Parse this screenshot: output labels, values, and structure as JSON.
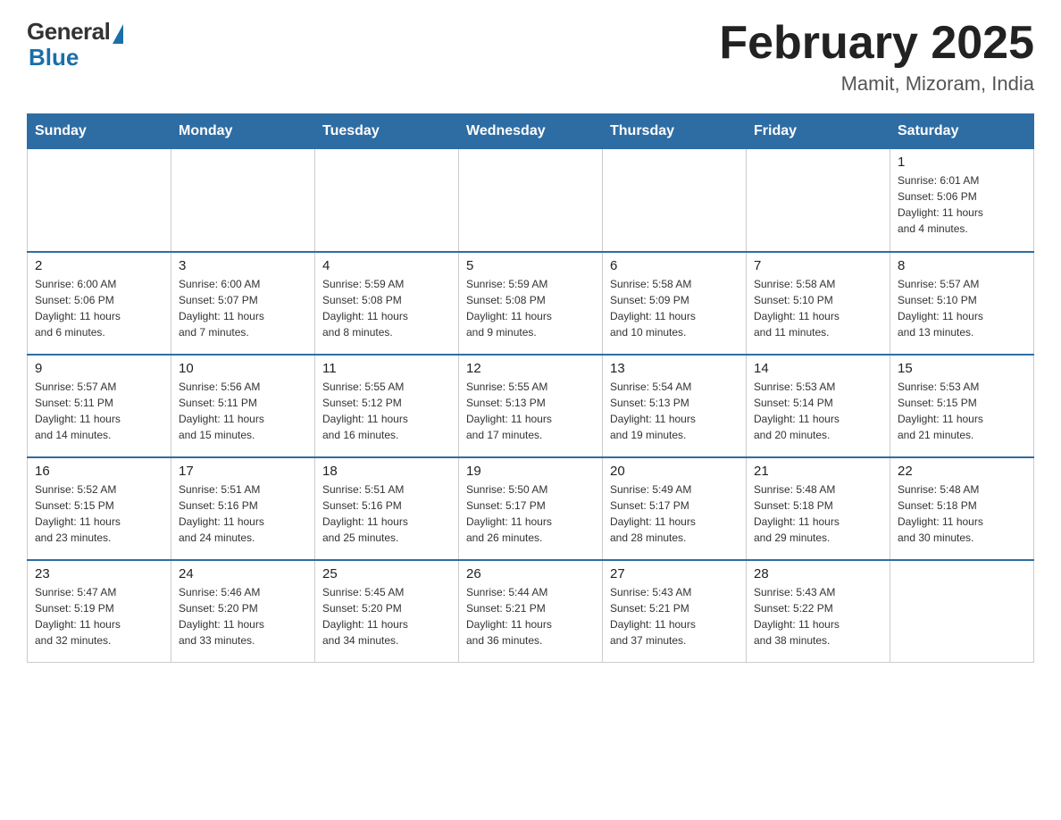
{
  "header": {
    "logo_general": "General",
    "logo_blue": "Blue",
    "month_title": "February 2025",
    "location": "Mamit, Mizoram, India"
  },
  "days_of_week": [
    "Sunday",
    "Monday",
    "Tuesday",
    "Wednesday",
    "Thursday",
    "Friday",
    "Saturday"
  ],
  "weeks": [
    {
      "days": [
        {
          "number": "",
          "info": "",
          "empty": true
        },
        {
          "number": "",
          "info": "",
          "empty": true
        },
        {
          "number": "",
          "info": "",
          "empty": true
        },
        {
          "number": "",
          "info": "",
          "empty": true
        },
        {
          "number": "",
          "info": "",
          "empty": true
        },
        {
          "number": "",
          "info": "",
          "empty": true
        },
        {
          "number": "1",
          "info": "Sunrise: 6:01 AM\nSunset: 5:06 PM\nDaylight: 11 hours\nand 4 minutes."
        }
      ]
    },
    {
      "days": [
        {
          "number": "2",
          "info": "Sunrise: 6:00 AM\nSunset: 5:06 PM\nDaylight: 11 hours\nand 6 minutes."
        },
        {
          "number": "3",
          "info": "Sunrise: 6:00 AM\nSunset: 5:07 PM\nDaylight: 11 hours\nand 7 minutes."
        },
        {
          "number": "4",
          "info": "Sunrise: 5:59 AM\nSunset: 5:08 PM\nDaylight: 11 hours\nand 8 minutes."
        },
        {
          "number": "5",
          "info": "Sunrise: 5:59 AM\nSunset: 5:08 PM\nDaylight: 11 hours\nand 9 minutes."
        },
        {
          "number": "6",
          "info": "Sunrise: 5:58 AM\nSunset: 5:09 PM\nDaylight: 11 hours\nand 10 minutes."
        },
        {
          "number": "7",
          "info": "Sunrise: 5:58 AM\nSunset: 5:10 PM\nDaylight: 11 hours\nand 11 minutes."
        },
        {
          "number": "8",
          "info": "Sunrise: 5:57 AM\nSunset: 5:10 PM\nDaylight: 11 hours\nand 13 minutes."
        }
      ]
    },
    {
      "days": [
        {
          "number": "9",
          "info": "Sunrise: 5:57 AM\nSunset: 5:11 PM\nDaylight: 11 hours\nand 14 minutes."
        },
        {
          "number": "10",
          "info": "Sunrise: 5:56 AM\nSunset: 5:11 PM\nDaylight: 11 hours\nand 15 minutes."
        },
        {
          "number": "11",
          "info": "Sunrise: 5:55 AM\nSunset: 5:12 PM\nDaylight: 11 hours\nand 16 minutes."
        },
        {
          "number": "12",
          "info": "Sunrise: 5:55 AM\nSunset: 5:13 PM\nDaylight: 11 hours\nand 17 minutes."
        },
        {
          "number": "13",
          "info": "Sunrise: 5:54 AM\nSunset: 5:13 PM\nDaylight: 11 hours\nand 19 minutes."
        },
        {
          "number": "14",
          "info": "Sunrise: 5:53 AM\nSunset: 5:14 PM\nDaylight: 11 hours\nand 20 minutes."
        },
        {
          "number": "15",
          "info": "Sunrise: 5:53 AM\nSunset: 5:15 PM\nDaylight: 11 hours\nand 21 minutes."
        }
      ]
    },
    {
      "days": [
        {
          "number": "16",
          "info": "Sunrise: 5:52 AM\nSunset: 5:15 PM\nDaylight: 11 hours\nand 23 minutes."
        },
        {
          "number": "17",
          "info": "Sunrise: 5:51 AM\nSunset: 5:16 PM\nDaylight: 11 hours\nand 24 minutes."
        },
        {
          "number": "18",
          "info": "Sunrise: 5:51 AM\nSunset: 5:16 PM\nDaylight: 11 hours\nand 25 minutes."
        },
        {
          "number": "19",
          "info": "Sunrise: 5:50 AM\nSunset: 5:17 PM\nDaylight: 11 hours\nand 26 minutes."
        },
        {
          "number": "20",
          "info": "Sunrise: 5:49 AM\nSunset: 5:17 PM\nDaylight: 11 hours\nand 28 minutes."
        },
        {
          "number": "21",
          "info": "Sunrise: 5:48 AM\nSunset: 5:18 PM\nDaylight: 11 hours\nand 29 minutes."
        },
        {
          "number": "22",
          "info": "Sunrise: 5:48 AM\nSunset: 5:18 PM\nDaylight: 11 hours\nand 30 minutes."
        }
      ]
    },
    {
      "days": [
        {
          "number": "23",
          "info": "Sunrise: 5:47 AM\nSunset: 5:19 PM\nDaylight: 11 hours\nand 32 minutes."
        },
        {
          "number": "24",
          "info": "Sunrise: 5:46 AM\nSunset: 5:20 PM\nDaylight: 11 hours\nand 33 minutes."
        },
        {
          "number": "25",
          "info": "Sunrise: 5:45 AM\nSunset: 5:20 PM\nDaylight: 11 hours\nand 34 minutes."
        },
        {
          "number": "26",
          "info": "Sunrise: 5:44 AM\nSunset: 5:21 PM\nDaylight: 11 hours\nand 36 minutes."
        },
        {
          "number": "27",
          "info": "Sunrise: 5:43 AM\nSunset: 5:21 PM\nDaylight: 11 hours\nand 37 minutes."
        },
        {
          "number": "28",
          "info": "Sunrise: 5:43 AM\nSunset: 5:22 PM\nDaylight: 11 hours\nand 38 minutes."
        },
        {
          "number": "",
          "info": "",
          "empty": true
        }
      ]
    }
  ]
}
